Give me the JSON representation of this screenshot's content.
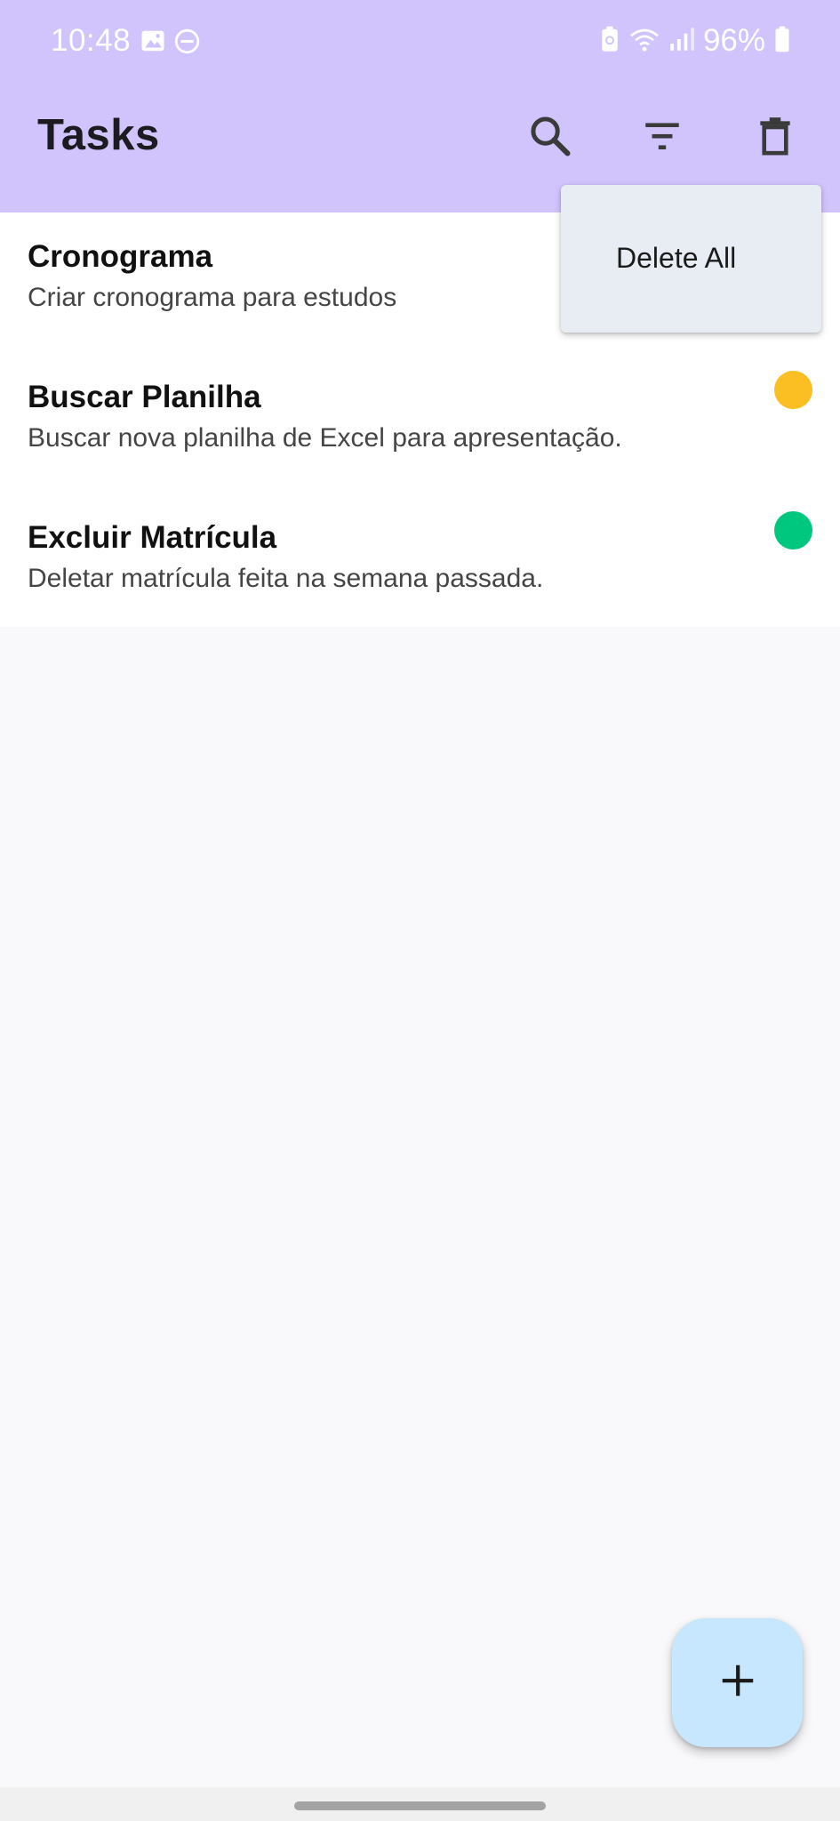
{
  "status_bar": {
    "time": "10:48",
    "battery_text": "96%",
    "icons": [
      "image-icon",
      "do-not-disturb-icon",
      "battery-saver-icon",
      "wifi-icon",
      "signal-icon",
      "battery-icon"
    ]
  },
  "toolbar": {
    "title": "Tasks",
    "icons": [
      "search-icon",
      "filter-icon",
      "delete-icon"
    ]
  },
  "menu": {
    "items": [
      {
        "label": "Delete All"
      }
    ]
  },
  "tasks": [
    {
      "title": "Cronograma",
      "description": "Criar cronograma para estudos",
      "priority_color": "#fe5b5b"
    },
    {
      "title": "Buscar Planilha",
      "description": "Buscar nova planilha de Excel para apresentação.",
      "priority_color": "#fbbf23"
    },
    {
      "title": "Excluir Matrícula",
      "description": "Deletar matrícula feita na semana passada.",
      "priority_color": "#00c77e"
    }
  ],
  "fab": {
    "icon": "add-icon"
  },
  "colors": {
    "appbar": "#d1c4fd",
    "menu_background": "#e7edf2",
    "fab_background": "#c7e7fe"
  }
}
